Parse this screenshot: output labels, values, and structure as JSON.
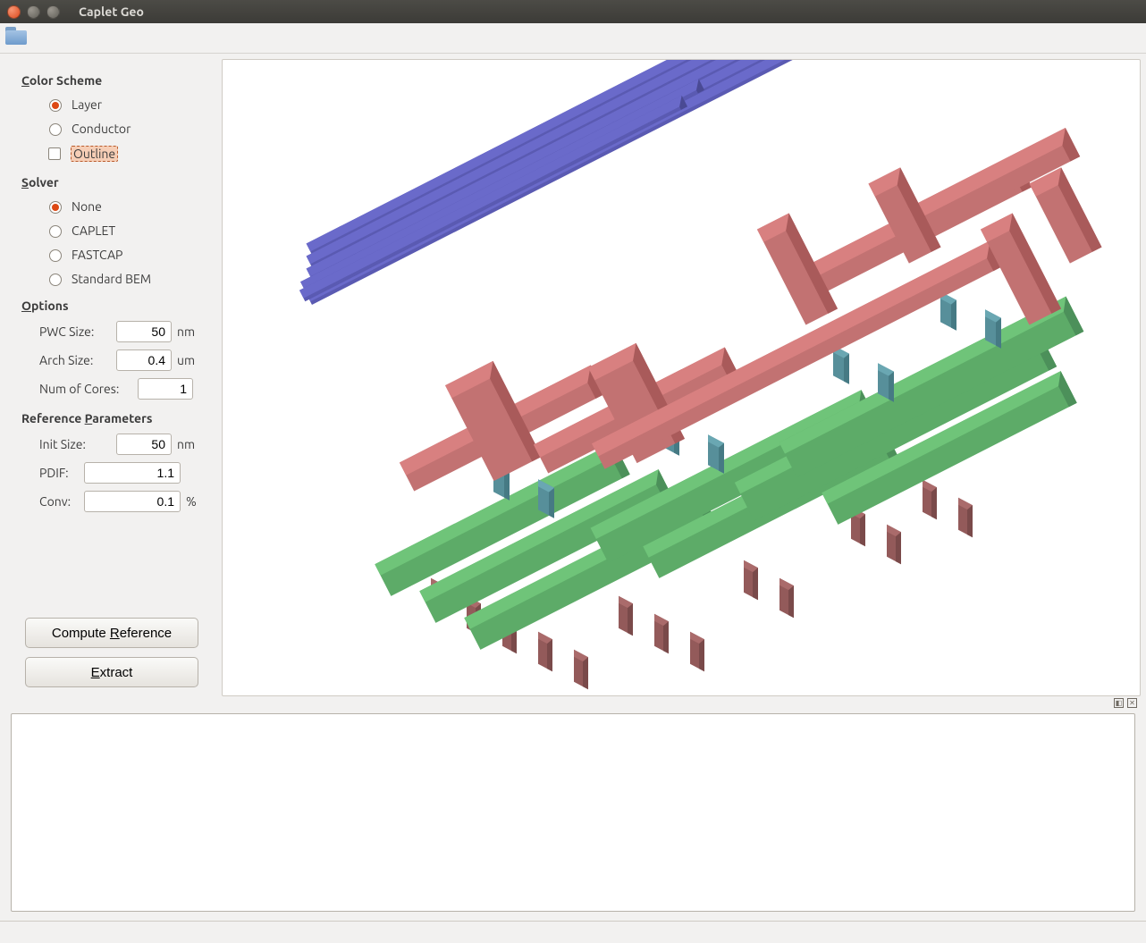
{
  "window": {
    "title": "Caplet Geo"
  },
  "sidepanel": {
    "color_scheme": {
      "title": "Color Scheme",
      "mnemonic": "C",
      "options": {
        "layer": "Layer",
        "conductor": "Conductor"
      },
      "selected": "Layer",
      "outline": {
        "label": "Outline",
        "checked": false
      }
    },
    "solver": {
      "title": "Solver",
      "mnemonic": "S",
      "options": {
        "none": "None",
        "caplet": "CAPLET",
        "fastcap": "FASTCAP",
        "stdbem": "Standard BEM"
      },
      "selected": "None"
    },
    "options": {
      "title": "Options",
      "mnemonic": "O",
      "pwc_size": {
        "label": "PWC Size:",
        "value": "50",
        "unit": "nm"
      },
      "arch_size": {
        "label": "Arch Size:",
        "value": "0.4",
        "unit": "um"
      },
      "num_cores": {
        "label": "Num of Cores:",
        "value": "1",
        "unit": ""
      }
    },
    "ref_params": {
      "title": "Reference Parameters",
      "mnemonic": "P",
      "init_size": {
        "label": "Init Size:",
        "value": "50",
        "unit": "nm"
      },
      "pdif": {
        "label": "PDIF:",
        "value": "1.1",
        "unit": ""
      },
      "conv": {
        "label": "Conv:",
        "value": "0.1",
        "unit": "%"
      }
    },
    "buttons": {
      "compute_ref": "Compute Reference",
      "compute_mnemonic": "R",
      "extract": "Extract",
      "extract_mnemonic": "E"
    }
  },
  "viewport": {
    "layer_colors": {
      "metal_top": "#d88080",
      "metal_mid": "#6fc479",
      "via": "#6aa7b2",
      "diffusion": "#aa6b6b",
      "poly": "#6a6aca"
    }
  },
  "log": {
    "content": ""
  }
}
